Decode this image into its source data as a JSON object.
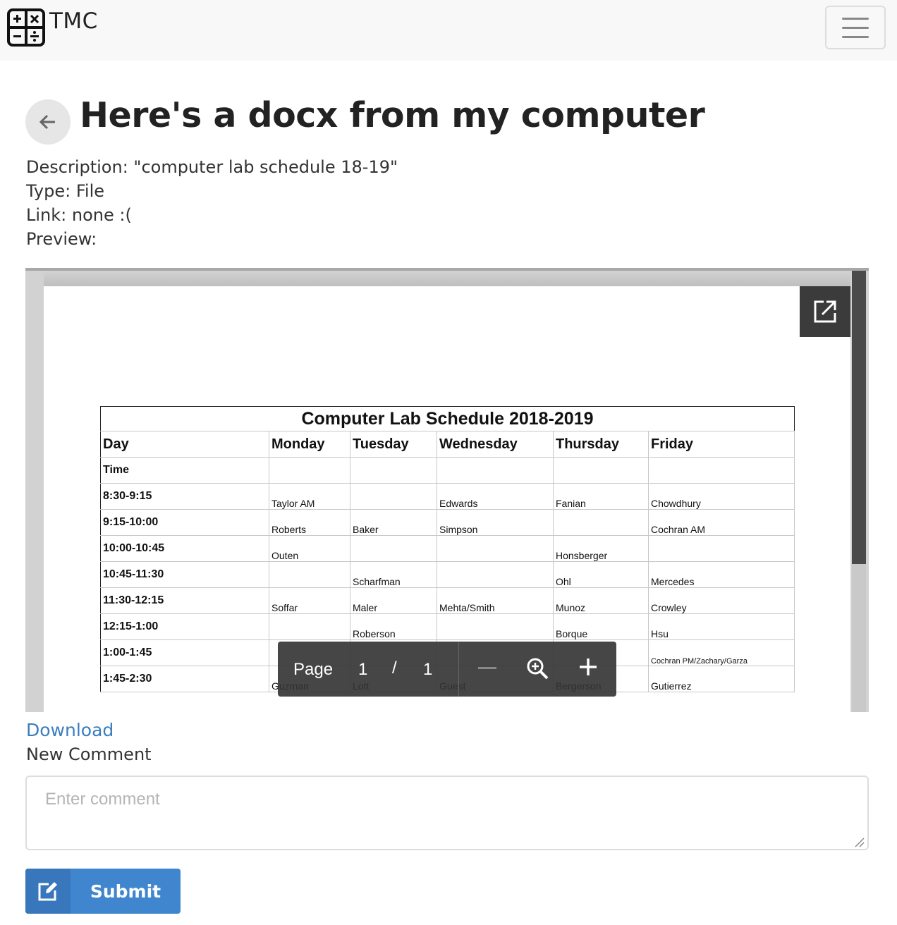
{
  "navbar": {
    "brand": "TMC",
    "logo_icon": "calculator-icon",
    "menu_icon": "hamburger-menu-icon"
  },
  "header": {
    "back_icon": "arrow-left-icon",
    "title": "Here's a docx from my computer"
  },
  "details": {
    "description": "Description: \"computer lab schedule 18-19\"",
    "type": "Type: File",
    "link": "Link: none :(",
    "preview": "Preview:"
  },
  "viewer": {
    "popout_icon": "external-link-icon",
    "toolbar": {
      "page_label": "Page",
      "current_page": "1",
      "separator": "/",
      "total_pages": "1",
      "zoom_out_icon": "minus-icon",
      "zoom_icon": "zoom-in-icon",
      "zoom_in_icon": "plus-icon"
    },
    "document": {
      "title": "Computer Lab Schedule 2018-2019",
      "headers": [
        "Day",
        "Monday",
        "Tuesday",
        "Wednesday",
        "Thursday",
        "Friday"
      ],
      "time_label": "Time",
      "rows": [
        {
          "time": "8:30-9:15",
          "cells": [
            "Taylor AM",
            "",
            "Edwards",
            "Fanian",
            "Chowdhury"
          ]
        },
        {
          "time": "9:15-10:00",
          "cells": [
            "Roberts",
            "Baker",
            "Simpson",
            "",
            "Cochran AM"
          ]
        },
        {
          "time": "10:00-10:45",
          "cells": [
            "Outen",
            "",
            "",
            "Honsberger",
            ""
          ]
        },
        {
          "time": "10:45-11:30",
          "cells": [
            "",
            "Scharfman",
            "",
            "Ohl",
            "Mercedes"
          ]
        },
        {
          "time": "11:30-12:15",
          "cells": [
            "Soffar",
            "Maler",
            "Mehta/Smith",
            "Munoz",
            "Crowley"
          ]
        },
        {
          "time": "12:15-1:00",
          "cells": [
            "",
            "Roberson",
            "",
            "Borque",
            "Hsu"
          ]
        },
        {
          "time": "1:00-1:45",
          "cells": [
            "",
            "",
            "",
            "",
            "Cochran PM/Zachary/Garza"
          ]
        },
        {
          "time": "1:45-2:30",
          "cells": [
            "Guzman",
            "Lott",
            "Guest",
            "Bergerson",
            "Gutierrez"
          ]
        }
      ]
    }
  },
  "actions": {
    "download": "Download",
    "new_comment": "New Comment",
    "comment_placeholder": "Enter comment",
    "comment_value": "",
    "submit_icon": "edit-icon",
    "submit": "Submit"
  }
}
